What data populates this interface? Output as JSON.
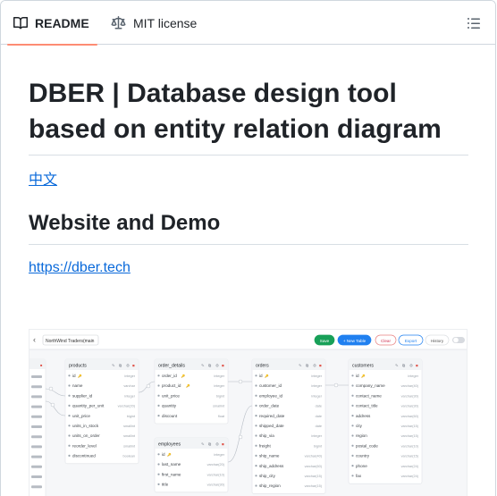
{
  "tabs": [
    {
      "label": "README",
      "icon": "book-icon",
      "active": true
    },
    {
      "label": "MIT license",
      "icon": "scale-icon",
      "active": false
    }
  ],
  "toc_icon": "list-icon",
  "heading": "DBER | Database design tool based on entity relation diagram",
  "lang_link": "中文",
  "section_heading": "Website and Demo",
  "site_link": "https://dber.tech",
  "demo": {
    "graph_name": "NorthWind Traders(main",
    "buttons": {
      "save": "Save",
      "new_table": "+ New Table",
      "clear": "Clear",
      "export": "Export",
      "history": "History"
    },
    "tables": [
      {
        "name": "products",
        "fields": [
          {
            "name": "id",
            "type": "integer",
            "pk": true
          },
          {
            "name": "name",
            "type": "varchar"
          },
          {
            "name": "supplier_id",
            "type": "integer"
          },
          {
            "name": "quantity_per_unit",
            "type": "varchar(20)"
          },
          {
            "name": "unit_price",
            "type": "bigint"
          },
          {
            "name": "units_in_stock",
            "type": "smallint"
          },
          {
            "name": "units_on_order",
            "type": "smallint"
          },
          {
            "name": "reorder_level",
            "type": "smallint"
          },
          {
            "name": "discontinued",
            "type": "boolean"
          }
        ]
      },
      {
        "name": "order_details",
        "fields": [
          {
            "name": "order_id",
            "type": "integer",
            "pk": true
          },
          {
            "name": "product_id",
            "type": "integer",
            "pk": true
          },
          {
            "name": "unit_price",
            "type": "bigint"
          },
          {
            "name": "quantity",
            "type": "smallint"
          },
          {
            "name": "discount",
            "type": "float"
          }
        ]
      },
      {
        "name": "employees",
        "fields": [
          {
            "name": "id",
            "type": "integer",
            "pk": true
          },
          {
            "name": "last_name",
            "type": "varchar(20)"
          },
          {
            "name": "first_name",
            "type": "varchar(10)"
          },
          {
            "name": "title",
            "type": "varchar(30)"
          }
        ]
      },
      {
        "name": "orders",
        "fields": [
          {
            "name": "id",
            "type": "integer",
            "pk": true
          },
          {
            "name": "customer_id",
            "type": "integer"
          },
          {
            "name": "employee_id",
            "type": "integer"
          },
          {
            "name": "order_date",
            "type": "date"
          },
          {
            "name": "required_date",
            "type": "date"
          },
          {
            "name": "shipped_date",
            "type": "date"
          },
          {
            "name": "ship_via",
            "type": "integer"
          },
          {
            "name": "freight",
            "type": "bigint"
          },
          {
            "name": "ship_name",
            "type": "varchar(40)"
          },
          {
            "name": "ship_address",
            "type": "varchar(60)"
          },
          {
            "name": "ship_city",
            "type": "varchar(15)"
          },
          {
            "name": "ship_region",
            "type": "varchar(15)"
          }
        ]
      },
      {
        "name": "customers",
        "fields": [
          {
            "name": "id",
            "type": "integer",
            "pk": true
          },
          {
            "name": "company_name",
            "type": "varchar(40)"
          },
          {
            "name": "contact_name",
            "type": "varchar(30)"
          },
          {
            "name": "contact_title",
            "type": "varchar(30)"
          },
          {
            "name": "address",
            "type": "varchar(60)"
          },
          {
            "name": "city",
            "type": "varchar(15)"
          },
          {
            "name": "region",
            "type": "varchar(15)"
          },
          {
            "name": "postal_code",
            "type": "varchar(10)"
          },
          {
            "name": "country",
            "type": "varchar(15)"
          },
          {
            "name": "phone",
            "type": "varchar(24)"
          },
          {
            "name": "fax",
            "type": "varchar(24)"
          }
        ]
      }
    ]
  }
}
